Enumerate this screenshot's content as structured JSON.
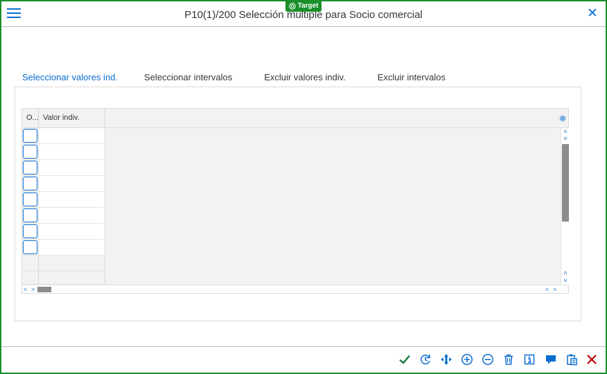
{
  "badge": {
    "label": "Target",
    "color": "#1a8f2a"
  },
  "dialog": {
    "title": "P10(1)/200 Selección múltiple para Socio comercial"
  },
  "icons": {
    "menu": "hamburger-icon",
    "close": "close-icon",
    "settings": "gear-icon"
  },
  "tabs": [
    {
      "label": "Seleccionar valores ind.",
      "active": true
    },
    {
      "label": "Seleccionar intervalos",
      "active": false
    },
    {
      "label": "Excluir valores indiv.",
      "active": false
    },
    {
      "label": "Excluir intervalos",
      "active": false
    }
  ],
  "grid": {
    "columns": [
      "O...",
      "Valor indiv."
    ],
    "rows": [
      {
        "option": "",
        "value": ""
      },
      {
        "option": "",
        "value": ""
      },
      {
        "option": "",
        "value": ""
      },
      {
        "option": "",
        "value": ""
      },
      {
        "option": "",
        "value": ""
      },
      {
        "option": "",
        "value": ""
      },
      {
        "option": "",
        "value": ""
      },
      {
        "option": "",
        "value": ""
      }
    ]
  },
  "toolbar": [
    {
      "name": "confirm-button",
      "icon": "checkmark-icon",
      "color": "#107e3e"
    },
    {
      "name": "multiple-selection-button",
      "icon": "history-icon",
      "color": "#0a6ed1"
    },
    {
      "name": "move-button",
      "icon": "move-icon",
      "color": "#0a6ed1"
    },
    {
      "name": "insert-line-button",
      "icon": "add-icon",
      "color": "#0a6ed1"
    },
    {
      "name": "delete-line-button",
      "icon": "remove-icon",
      "color": "#0a6ed1"
    },
    {
      "name": "delete-all-button",
      "icon": "trash-icon",
      "color": "#0a6ed1"
    },
    {
      "name": "info-button",
      "icon": "info-icon",
      "color": "#0a6ed1"
    },
    {
      "name": "comment-button",
      "icon": "message-icon",
      "color": "#0a6ed1"
    },
    {
      "name": "upload-clipboard-button",
      "icon": "clipboard-icon",
      "color": "#0a6ed1"
    },
    {
      "name": "cancel-button",
      "icon": "cancel-icon",
      "color": "#bb0000"
    }
  ]
}
